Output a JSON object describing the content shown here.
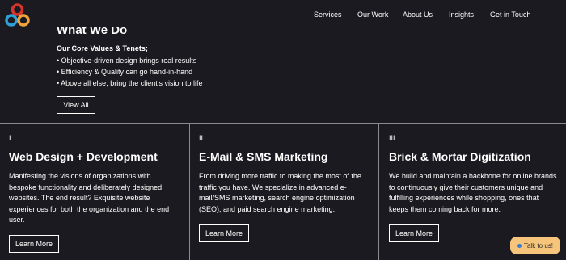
{
  "nav": {
    "items": [
      "Services",
      "Our Work",
      "About Us",
      "Insights",
      "Get in Touch"
    ]
  },
  "hero": {
    "title": "What We Do",
    "core_heading": "Our Core Values & Tenets;",
    "bullets": [
      "Objective-driven design brings real results",
      "Efficiency & Quality can go hand-in-hand",
      "Above all else, bring the client's vision to life"
    ],
    "view_all": "View All"
  },
  "cards": [
    {
      "number": "I",
      "title": "Web Design + Development",
      "lines": [
        "Manifesting the visions of organizations with",
        "bespoke functionality and deliberately designed",
        "websites. The end result? Exquisite website",
        "experiences for both the organization and the end",
        "user."
      ],
      "button": "Learn More"
    },
    {
      "number": "II",
      "title": "E-Mail & SMS Marketing",
      "lines": [
        "From driving more traffic to making the most of the",
        "traffic you have. We specialize in advanced e-",
        "mail/SMS marketing, search engine optimization",
        "(SEO), and paid search engine marketing."
      ],
      "button": "Learn More"
    },
    {
      "number": "III",
      "title": "Brick & Mortar Digitization",
      "lines": [
        "We build and maintain a backbone for online brands",
        "to continuously give their customers unique and",
        "fulfilling experiences while shopping, ones that",
        "keeps them coming back for more."
      ],
      "button": "Learn More"
    }
  ],
  "chat": {
    "label": "Talk to us!"
  },
  "colors": {
    "background": "#1b1a20",
    "logo_red": "#d8342b",
    "logo_orange": "#f2a23b",
    "logo_blue": "#2f9fd6",
    "chat_bg": "#f6c57b"
  }
}
